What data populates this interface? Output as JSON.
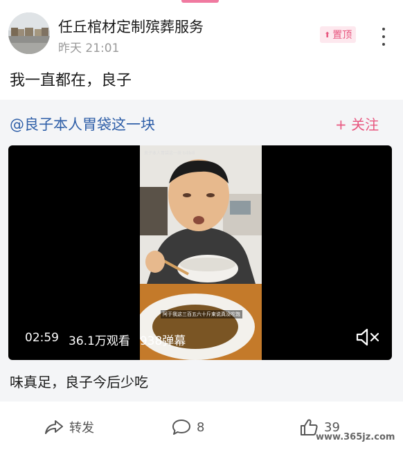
{
  "post": {
    "author": "任丘棺材定制殡葬服务",
    "time": "昨天 21:01",
    "pin_label": "置顶",
    "text": "我一直都在，良子"
  },
  "shared": {
    "title": "@良子本人胃袋这一块",
    "follow_label": "+ 关注",
    "video": {
      "duration": "02:59",
      "views": "36.1万观看",
      "danmaku": "938弹幕",
      "overlay_title": "良子本人胃袋这一块 bilibili",
      "overlay_caption": "阿于我这三百五六十斤束说真没吃饱"
    },
    "description": "味真足，良子今后少吃"
  },
  "actions": {
    "share_label": "转发",
    "comment_count": "8",
    "like_count": "39"
  },
  "watermark": "www.365jz.com",
  "colors": {
    "accent_pink": "#e8567f",
    "link_blue": "#2f5fa8",
    "card_bg": "#f4f5f7"
  },
  "icons": [
    "more-icon",
    "pin-arrow-icon",
    "mute-icon",
    "share-icon",
    "comment-icon",
    "like-icon"
  ]
}
